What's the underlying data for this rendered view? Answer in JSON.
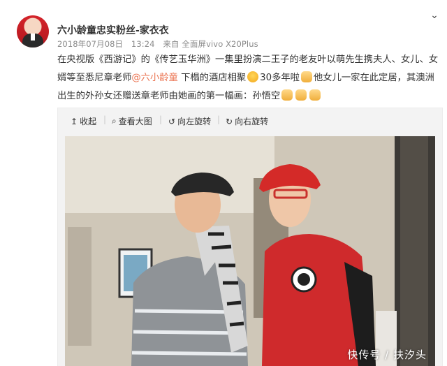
{
  "author": {
    "name": "六小龄童忠实粉丝-家衣衣",
    "date": "2018年07月08日",
    "time": "13:24",
    "source": "来自 全面屏vivo X20Plus"
  },
  "post": {
    "text_1": "在央视版《西游记》的《传艺玉华洲》一集里扮演二王子的老友叶以萌先生携夫人、女儿、女婿等至悉尼章老师",
    "mention": "@六小龄童",
    "text_2": "下榻的酒店相聚",
    "text_3": "30多年啦",
    "text_4": "他女儿一家在此定居，其澳洲出生的外孙女还赠送章老师由她画的第一幅画：孙悟空"
  },
  "toolbar": {
    "collapse": "收起",
    "view_large": "查看大图",
    "rotate_left": "向左旋转",
    "rotate_right": "向右旋转"
  },
  "image": {
    "watermark": "快传号 / 扶汐头"
  },
  "colors": {
    "mention": "#eb7350",
    "cap_red": "#d42a28",
    "jacket_red": "#cf2a2c"
  }
}
